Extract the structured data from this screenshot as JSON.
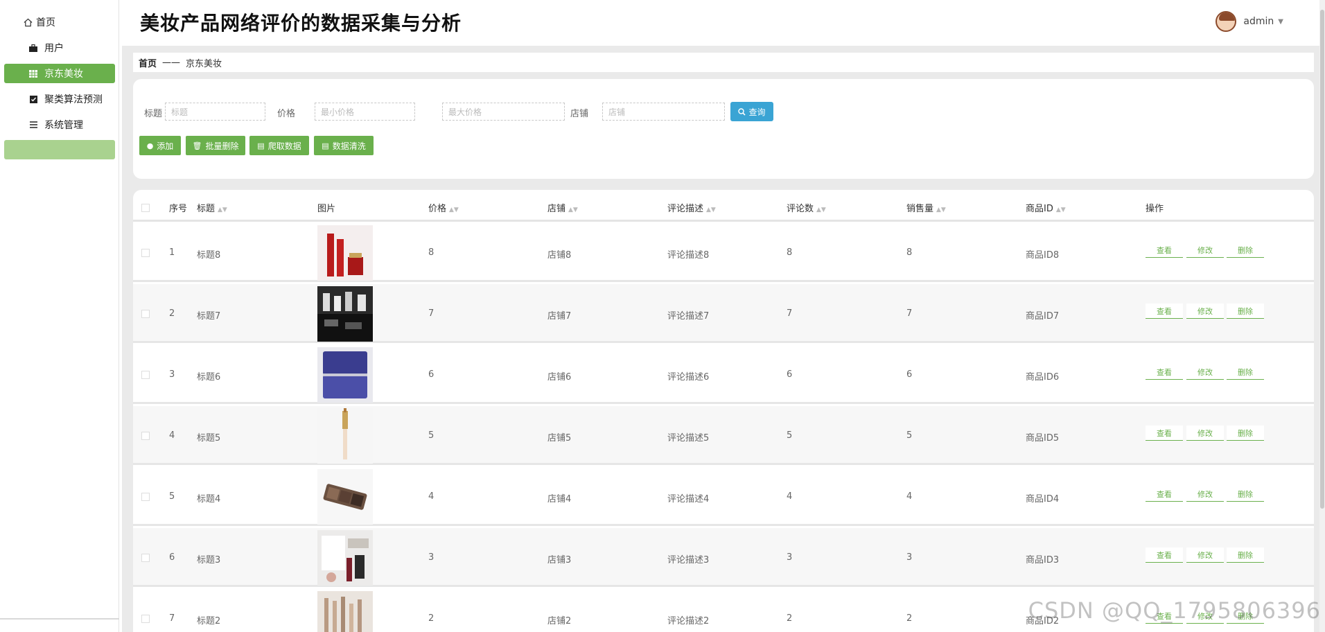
{
  "app": {
    "title": "美妆产品网络评价的数据采集与分析",
    "user_name": "admin"
  },
  "sidebar": {
    "items": [
      {
        "label": "首页",
        "icon": "home-icon"
      },
      {
        "label": "用户",
        "icon": "briefcase-icon"
      },
      {
        "label": "京东美妆",
        "icon": "table-icon",
        "active": true
      },
      {
        "label": "聚类算法预测",
        "icon": "checkbox-icon"
      },
      {
        "label": "系统管理",
        "icon": "list-icon"
      }
    ]
  },
  "breadcrumb": {
    "home": "首页",
    "separator": "——",
    "current": "京东美妆"
  },
  "search": {
    "title_label": "标题",
    "title_placeholder": "标题",
    "price_label": "价格",
    "min_price_placeholder": "最小价格",
    "max_price_placeholder": "最大价格",
    "shop_label": "店铺",
    "shop_placeholder": "店铺",
    "search_button": "查询"
  },
  "toolbar": {
    "add": "添加",
    "batch_delete": "批量删除",
    "crawl": "爬取数据",
    "clean": "数据清洗"
  },
  "table": {
    "columns": [
      "序号",
      "标题",
      "图片",
      "价格",
      "店铺",
      "评论描述",
      "评论数",
      "销售量",
      "商品ID",
      "操作"
    ],
    "actions": {
      "view": "查看",
      "edit": "修改",
      "delete": "删除"
    },
    "rows": [
      {
        "index": "1",
        "title": "标题8",
        "price": "8",
        "shop": "店铺8",
        "desc": "评论描述8",
        "comments": "8",
        "sales": "8",
        "product_id": "商品ID8",
        "image": "red-skincare-set"
      },
      {
        "index": "2",
        "title": "标题7",
        "price": "7",
        "shop": "店铺7",
        "desc": "评论描述7",
        "comments": "7",
        "sales": "7",
        "product_id": "商品ID7",
        "image": "cosmetics-display"
      },
      {
        "index": "3",
        "title": "标题6",
        "price": "6",
        "shop": "店铺6",
        "desc": "评论描述6",
        "comments": "6",
        "sales": "6",
        "product_id": "商品ID6",
        "image": "purple-cream-jar"
      },
      {
        "index": "4",
        "title": "标题5",
        "price": "5",
        "shop": "店铺5",
        "desc": "评论描述5",
        "comments": "5",
        "sales": "5",
        "product_id": "商品ID5",
        "image": "gold-pen"
      },
      {
        "index": "5",
        "title": "标题4",
        "price": "4",
        "shop": "店铺4",
        "desc": "评论描述4",
        "comments": "4",
        "sales": "4",
        "product_id": "商品ID4",
        "image": "brow-palette"
      },
      {
        "index": "6",
        "title": "标题3",
        "price": "3",
        "shop": "店铺3",
        "desc": "评论描述3",
        "comments": "3",
        "sales": "3",
        "product_id": "商品ID3",
        "image": "makeup-flatlay"
      },
      {
        "index": "7",
        "title": "标题2",
        "price": "2",
        "shop": "店铺2",
        "desc": "评论描述2",
        "comments": "2",
        "sales": "2",
        "product_id": "商品ID2",
        "image": "brushes"
      }
    ]
  },
  "watermark": "CSDN @QQ_1795806396",
  "colors": {
    "accent": "#6ab04c",
    "search": "#3aa4d4",
    "active_nav": "#6ab04c"
  }
}
